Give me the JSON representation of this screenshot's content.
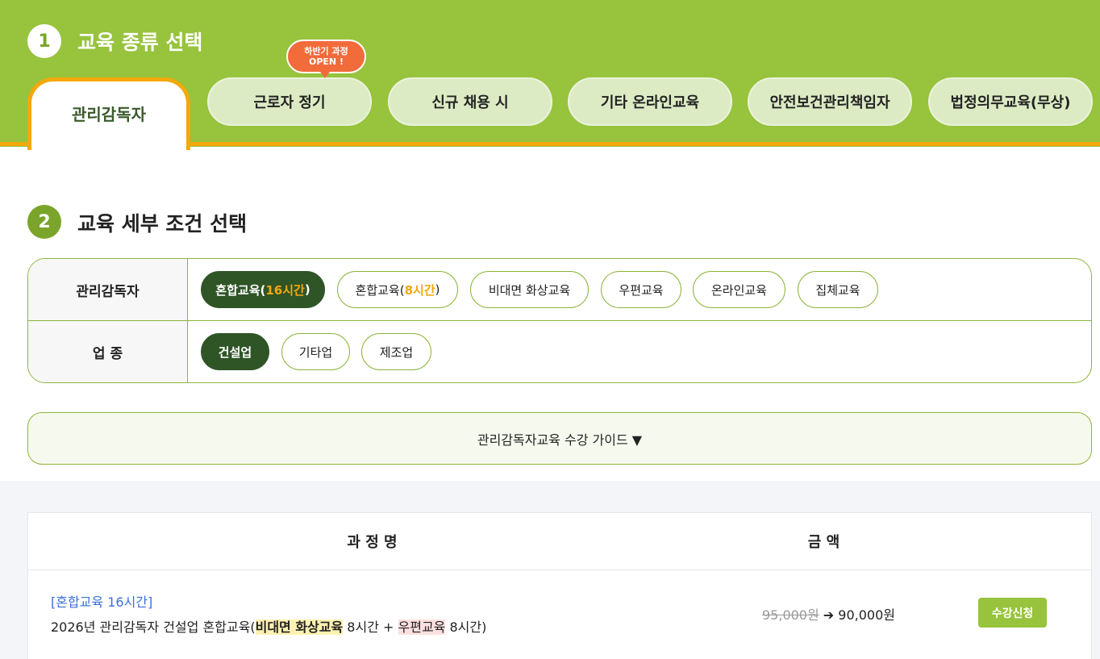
{
  "section1": {
    "number": "1",
    "title": "교육 종류 선택",
    "active_tab": "관리감독자",
    "tabs": [
      {
        "label": "근로자 정기"
      },
      {
        "label": "신규 채용 시"
      },
      {
        "label": "기타 온라인교육"
      },
      {
        "label": "안전보건관리책임자"
      },
      {
        "label": "법정의무교육(무상)"
      }
    ],
    "badge": {
      "line1": "하반기 과정",
      "line2": "OPEN !"
    }
  },
  "section2": {
    "number": "2",
    "title": "교육 세부 조건 선택",
    "rows": [
      {
        "label": "관리감독자",
        "chips": [
          {
            "pre": "혼합교육(",
            "hl": "16시간",
            "post": ")",
            "selected": true
          },
          {
            "pre": "혼합교육(",
            "hl": "8시간",
            "post": ")",
            "selected": false
          },
          {
            "text": "비대면 화상교육"
          },
          {
            "text": "우편교육"
          },
          {
            "text": "온라인교육"
          },
          {
            "text": "집체교육"
          }
        ]
      },
      {
        "label": "업 종",
        "chips": [
          {
            "text": "건설업",
            "selected": true
          },
          {
            "text": "기타업"
          },
          {
            "text": "제조업"
          }
        ]
      }
    ],
    "guide": "관리감독자교육 수강 가이드 ▼"
  },
  "table": {
    "headers": [
      "과 정 명",
      "금 액"
    ],
    "rows": [
      {
        "tag": "[혼합교육 16시간]",
        "name_pre": "2026년 관리감독자 건설업 혼합교육(",
        "mark1": "비대면 화상교육",
        "name_mid": " 8시간 + ",
        "mark2": "우편교육",
        "name_post": " 8시간)",
        "old_price": "95,000원",
        "arrow": " ➔ ",
        "new_price": "90,000원",
        "button": "수강신청"
      }
    ]
  },
  "colors": {
    "brand_green": "#97c33d",
    "dark_green": "#2f5527",
    "orange": "#f3a80c",
    "badge_red": "#f26b3a"
  }
}
